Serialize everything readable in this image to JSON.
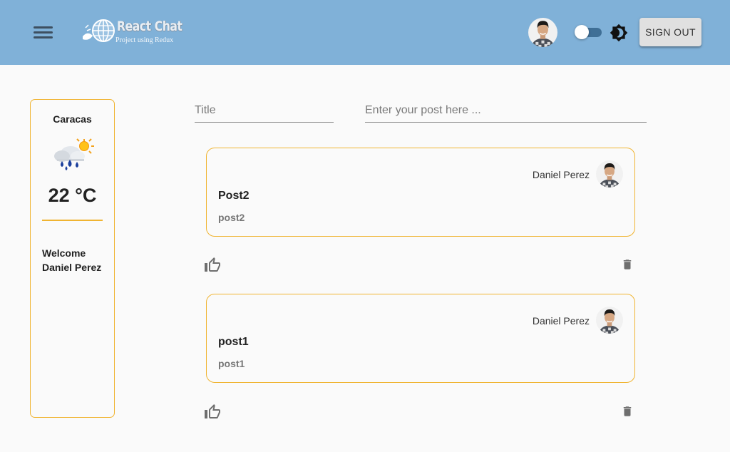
{
  "header": {
    "logo_title": "React Chat",
    "logo_subtitle": "Project using Redux",
    "theme_toggle": "off",
    "signout_label": "SIGN OUT"
  },
  "weather": {
    "city": "Caracas",
    "temperature": "22 °C",
    "icon": "rain-sun-icon",
    "welcome_line1": "Welcome",
    "welcome_line2": "Daniel Perez"
  },
  "composer": {
    "title_placeholder": "Title",
    "post_placeholder": "Enter your post here ..."
  },
  "posts": [
    {
      "author": "Daniel Perez",
      "title": "Post2",
      "body": "post2"
    },
    {
      "author": "Daniel Perez",
      "title": "post1",
      "body": "post1"
    }
  ],
  "colors": {
    "appbar": "#80b1d8",
    "accent_border": "#f0b431",
    "background": "#fafafa"
  }
}
